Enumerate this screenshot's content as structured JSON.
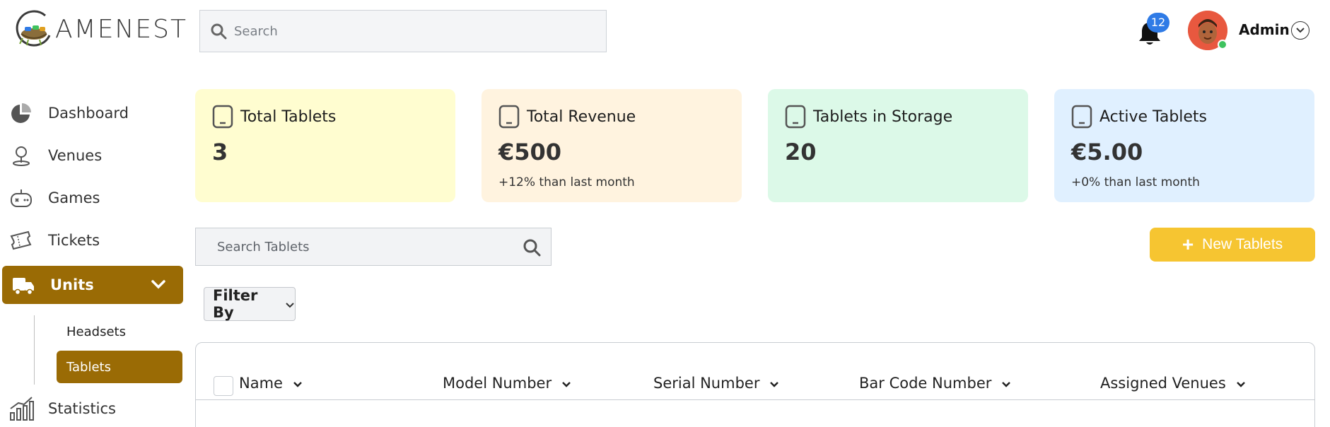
{
  "brand": {
    "logo_text": "AMENEST"
  },
  "search": {
    "placeholder": "Search"
  },
  "notifications": {
    "count": "12"
  },
  "user": {
    "name": "Admin"
  },
  "sidebar": {
    "items": [
      {
        "label": "Dashboard",
        "icon": "pie-chart-icon"
      },
      {
        "label": "Venues",
        "icon": "map-pin-icon"
      },
      {
        "label": "Games",
        "icon": "gamepad-icon"
      },
      {
        "label": "Tickets",
        "icon": "ticket-icon"
      },
      {
        "label": "Units",
        "icon": "truck-icon",
        "active": true
      },
      {
        "label": "Statistics",
        "icon": "bar-chart-icon"
      }
    ],
    "subitems": [
      {
        "label": "Headsets"
      },
      {
        "label": "Tablets",
        "active": true
      }
    ]
  },
  "cards": [
    {
      "title": "Total Tablets",
      "value": "3",
      "sub": "",
      "color": "#fffdd0"
    },
    {
      "title": "Total Revenue",
      "value": "€500",
      "sub": "+12% than last month",
      "color": "#fff3df"
    },
    {
      "title": "Tablets in Storage",
      "value": "20",
      "sub": "",
      "color": "#dcf9e8"
    },
    {
      "title": "Active Tablets",
      "value": "€5.00",
      "sub": "+0% than last month",
      "color": "#e0f0ff"
    }
  ],
  "toolbar": {
    "search_placeholder": "Search Tablets",
    "new_button": "New Tablets",
    "filter_label": "Filter By"
  },
  "table": {
    "columns": [
      "Name",
      "Model Number",
      "Serial Number",
      "Bar Code Number",
      "Assigned Venues"
    ]
  },
  "colors": {
    "accent": "#9a6b05",
    "button": "#f6c531",
    "badge": "#2f7be6"
  }
}
